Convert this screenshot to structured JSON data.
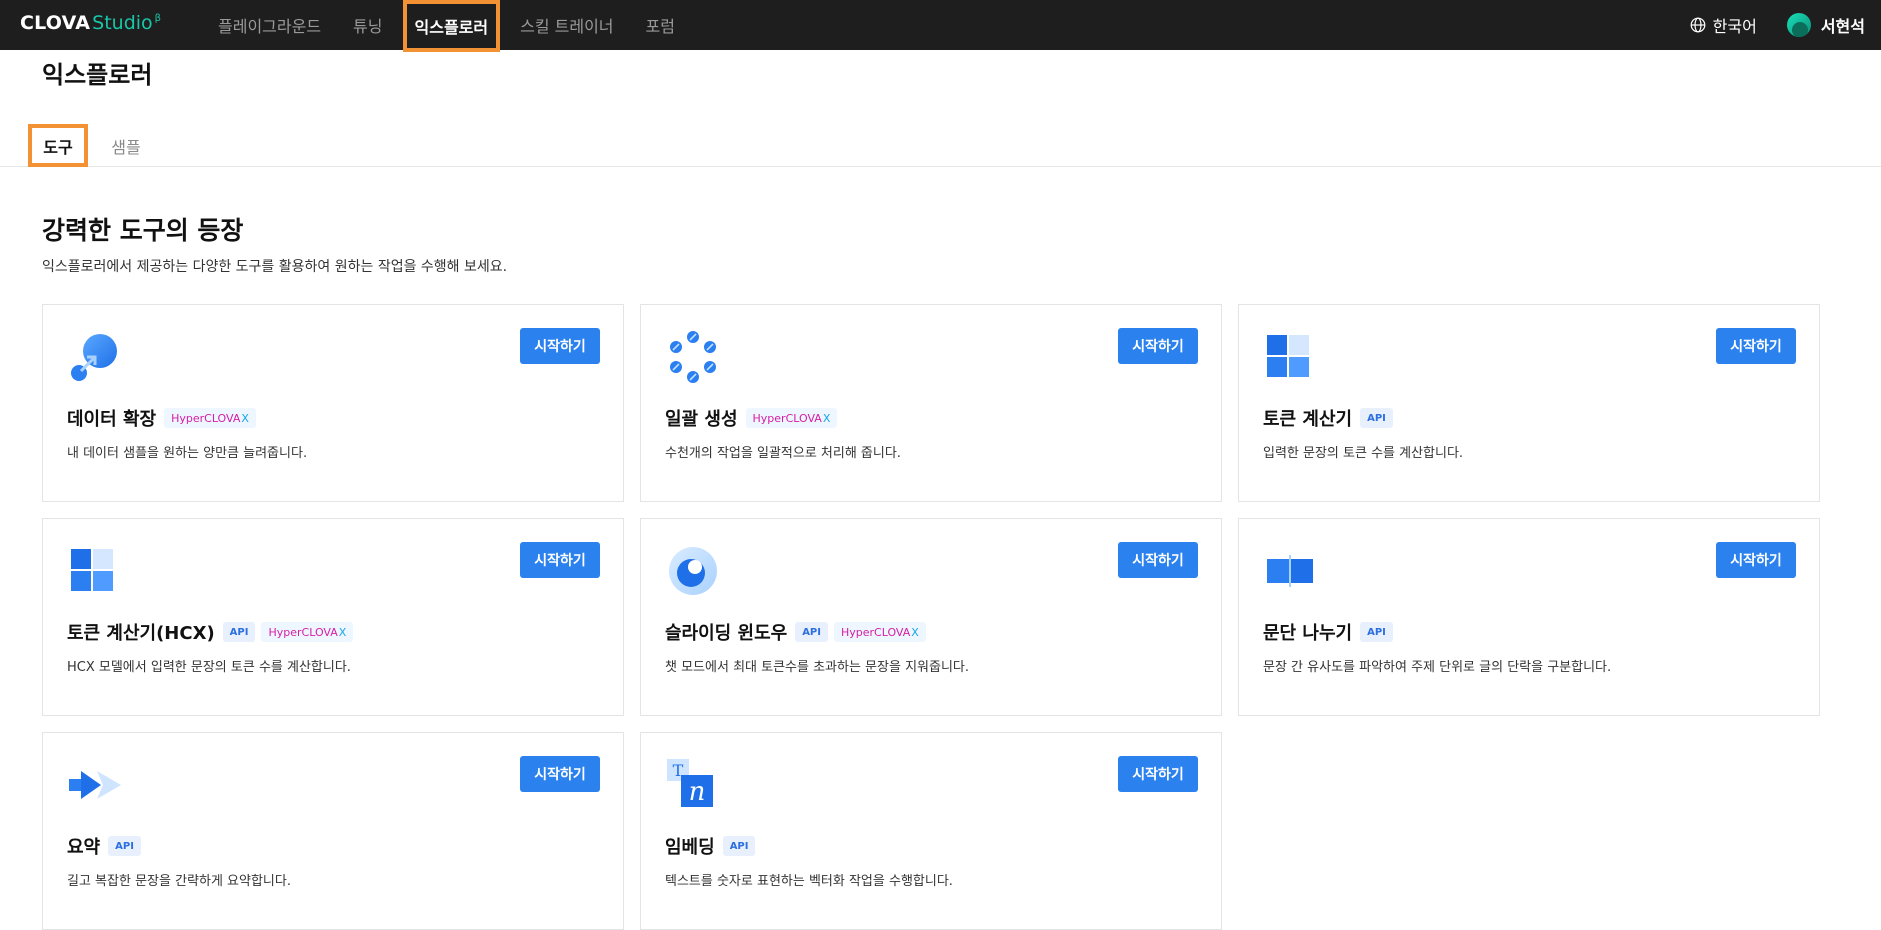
{
  "header": {
    "logo_main": "CLOVA",
    "logo_studio": "Studio",
    "logo_beta": "β",
    "nav": [
      {
        "label": "플레이그라운드"
      },
      {
        "label": "튜닝"
      },
      {
        "label": "익스플로러"
      },
      {
        "label": "스킬 트레이너"
      },
      {
        "label": "포럼"
      }
    ],
    "active_nav": "익스플로러",
    "language": "한국어",
    "user_name": "서현석"
  },
  "page": {
    "title": "익스플로러",
    "tabs": [
      {
        "label": "도구",
        "selected": true
      },
      {
        "label": "샘플",
        "selected": false
      }
    ],
    "section_title": "강력한 도구의 등장",
    "section_desc": "익스플로러에서 제공하는 다양한 도구를 활용하여 원하는 작업을 수행해 보세요."
  },
  "start_label": "시작하기",
  "badge_api": "API",
  "badge_hcx": "HyperCLOVA",
  "badge_hcx_x": "X",
  "colors": {
    "primary": "#2b82ef",
    "highlight": "#f39234",
    "topbar": "#1e1e1e",
    "brand": "#18c6a8"
  },
  "cards": [
    {
      "name": "데이터 확장",
      "badges": [
        "hcx"
      ],
      "desc": "내 데이터 샘플을 원하는 양만큼 늘려줍니다.",
      "icon": "data-expand-icon"
    },
    {
      "name": "일괄 생성",
      "badges": [
        "hcx"
      ],
      "desc": "수천개의 작업을 일괄적으로 처리해 줍니다.",
      "icon": "batch-generate-icon"
    },
    {
      "name": "토큰 계산기",
      "badges": [
        "api"
      ],
      "desc": "입력한 문장의 토큰 수를 계산합니다.",
      "icon": "token-calculator-icon"
    },
    {
      "name": "토큰 계산기(HCX)",
      "badges": [
        "api",
        "hcx"
      ],
      "desc": "HCX 모델에서 입력한 문장의 토큰 수를 계산합니다.",
      "icon": "token-calculator-hcx-icon"
    },
    {
      "name": "슬라이딩 윈도우",
      "badges": [
        "api",
        "hcx"
      ],
      "desc": "챗 모드에서 최대 토큰수를 초과하는 문장을 지워줍니다.",
      "icon": "sliding-window-icon"
    },
    {
      "name": "문단 나누기",
      "badges": [
        "api"
      ],
      "desc": "문장 간 유사도를 파악하여 주제 단위로 글의 단락을 구분합니다.",
      "icon": "paragraph-split-icon"
    },
    {
      "name": "요약",
      "badges": [
        "api"
      ],
      "desc": "길고 복잡한 문장을 간략하게 요약합니다.",
      "icon": "summary-icon"
    },
    {
      "name": "임베딩",
      "badges": [
        "api"
      ],
      "desc": "텍스트를 숫자로 표현하는 벡터화 작업을 수행합니다.",
      "icon": "embedding-icon"
    }
  ]
}
